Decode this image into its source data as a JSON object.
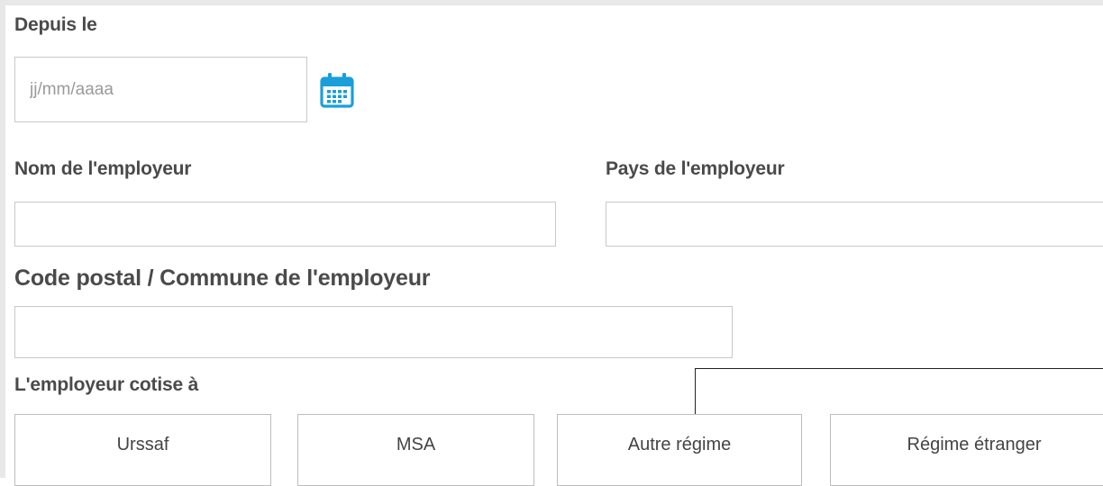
{
  "since": {
    "label": "Depuis le",
    "date_placeholder": "jj/mm/aaaa",
    "date_value": "",
    "calendar_icon": "calendar-icon"
  },
  "employer": {
    "name_label": "Nom de l'employeur",
    "name_value": "",
    "country_label": "Pays de l'employeur",
    "country_value": "",
    "postal_label": "Code postal / Commune de l'employeur",
    "postal_value": ""
  },
  "contributions": {
    "label": "L'employeur cotise à",
    "options": [
      {
        "label": "Urssaf"
      },
      {
        "label": "MSA"
      },
      {
        "label": "Autre régime"
      },
      {
        "label": "Régime étranger"
      }
    ]
  },
  "colors": {
    "icon_accent": "#1a9fd9",
    "label_text": "#4a4a4a",
    "border": "#c8c8c8"
  }
}
